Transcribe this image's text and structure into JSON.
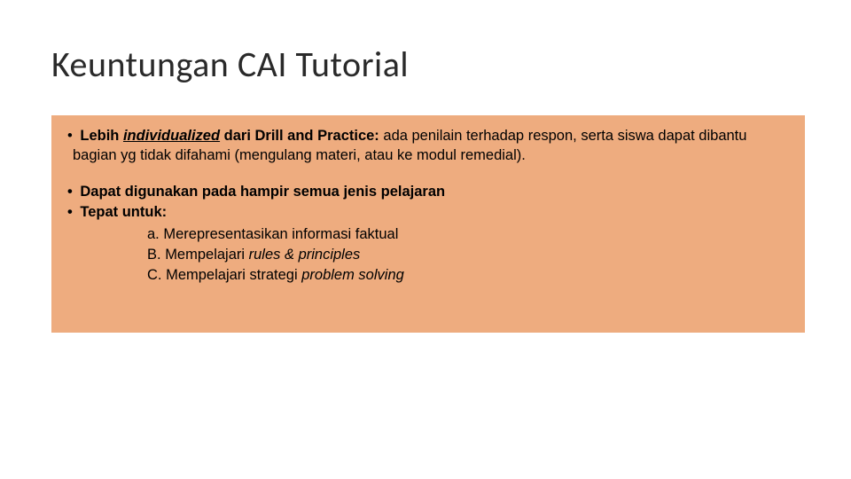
{
  "title": "Keuntungan CAI Tutorial",
  "box": {
    "p1": {
      "bullet": "•",
      "lead_bold": "Lebih ",
      "lead_ital_under": "individualized",
      "lead_bold2": " dari Drill and Practice:",
      "rest": " ada penilain terhadap respon, serta siswa dapat dibantu bagian yg tidak difahami (mengulang materi, atau ke modul remedial)."
    },
    "p2": {
      "bullet": "•",
      "text": " Dapat digunakan pada hampir semua jenis pelajaran"
    },
    "p3": {
      "bullet": "•",
      "text": " Tepat untuk:"
    },
    "sub": {
      "a": {
        "label": "a. ",
        "text": "Merepresentasikan informasi faktual"
      },
      "b": {
        "label": "B. ",
        "pre": "Mempelajari ",
        "ital": "rules & principles"
      },
      "c": {
        "label": "C. ",
        "pre": "Mempelajari strategi ",
        "ital": "problem solving"
      }
    }
  }
}
